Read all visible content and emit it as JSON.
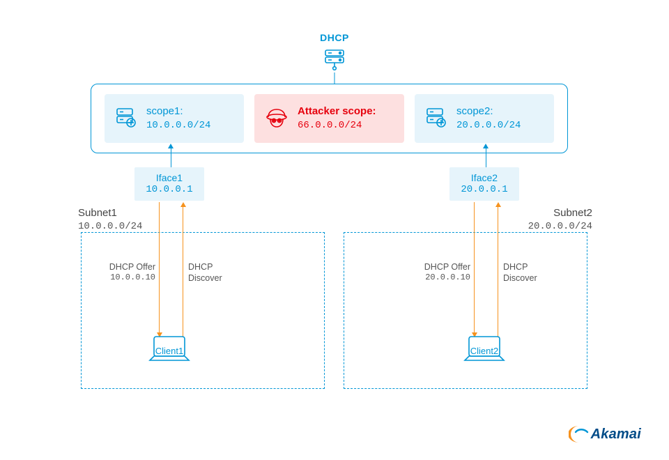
{
  "dhcp": {
    "title": "DHCP"
  },
  "scopes": {
    "scope1": {
      "name": "scope1:",
      "cidr": "10.0.0.0/24"
    },
    "attacker": {
      "name": "Attacker scope:",
      "cidr": "66.0.0.0/24"
    },
    "scope2": {
      "name": "scope2:",
      "cidr": "20.0.0.0/24"
    }
  },
  "ifaces": {
    "iface1": {
      "name": "Iface1",
      "ip": "10.0.0.1"
    },
    "iface2": {
      "name": "Iface2",
      "ip": "20.0.0.1"
    }
  },
  "subnets": {
    "subnet1": {
      "name": "Subnet1",
      "cidr": "10.0.0.0/24"
    },
    "subnet2": {
      "name": "Subnet2",
      "cidr": "20.0.0.0/24"
    }
  },
  "clients": {
    "client1": {
      "name": "Client1"
    },
    "client2": {
      "name": "Client2"
    }
  },
  "flows": {
    "offer_label": "DHCP Offer",
    "discover_label": "DHCP",
    "discover_label2": "Discover",
    "offer1_ip": "10.0.0.10",
    "offer2_ip": "20.0.0.10"
  },
  "logo": {
    "text": "Akamai"
  }
}
